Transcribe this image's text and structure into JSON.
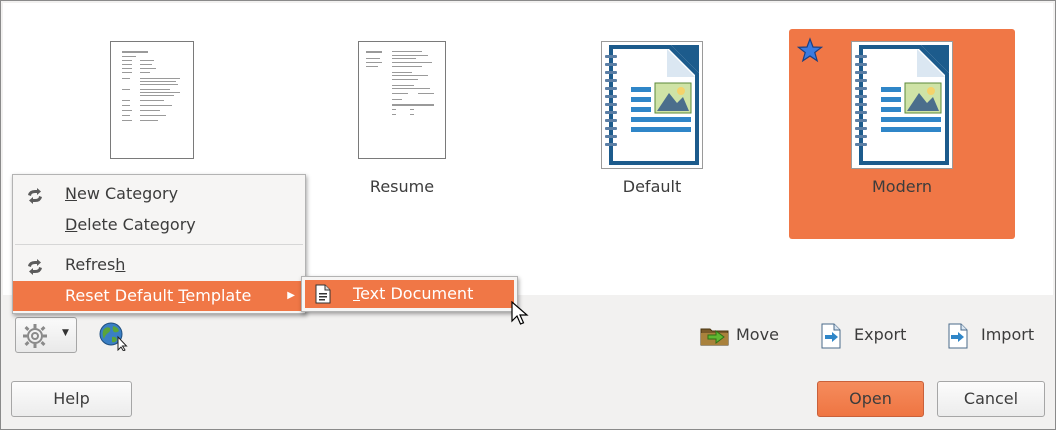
{
  "templates": [
    {
      "name": "",
      "thumbnail": "cover-letter-preview",
      "selected": false
    },
    {
      "name": "Resume",
      "thumbnail": "resume-preview",
      "selected": false
    },
    {
      "name": "Default",
      "thumbnail": "writer-document-icon",
      "selected": false
    },
    {
      "name": "Modern",
      "thumbnail": "writer-document-icon",
      "selected": true,
      "starred": true
    }
  ],
  "menu": {
    "items": [
      {
        "label": "New Category",
        "mnemonic_index": 0,
        "icon": "refresh-arrows-icon"
      },
      {
        "label": "Delete Category",
        "mnemonic_index": 0,
        "icon": ""
      },
      {
        "label": "Refresh",
        "mnemonic_index": 6,
        "icon": "refresh-arrows-icon"
      },
      {
        "label": "Reset Default Template",
        "mnemonic_index": 14,
        "icon": "",
        "has_submenu": true,
        "active": true
      }
    ],
    "submenu": {
      "label": "Text Document",
      "icon": "text-document-icon"
    }
  },
  "toolbar": {
    "move_label": "Move",
    "export_label": "Export",
    "import_label": "Import"
  },
  "buttons": {
    "help": "Help",
    "open": "Open",
    "cancel": "Cancel"
  },
  "colors": {
    "accent": "#f07746",
    "background": "#f2f1f0",
    "pane": "#ffffff",
    "text": "#3c3c3c"
  }
}
